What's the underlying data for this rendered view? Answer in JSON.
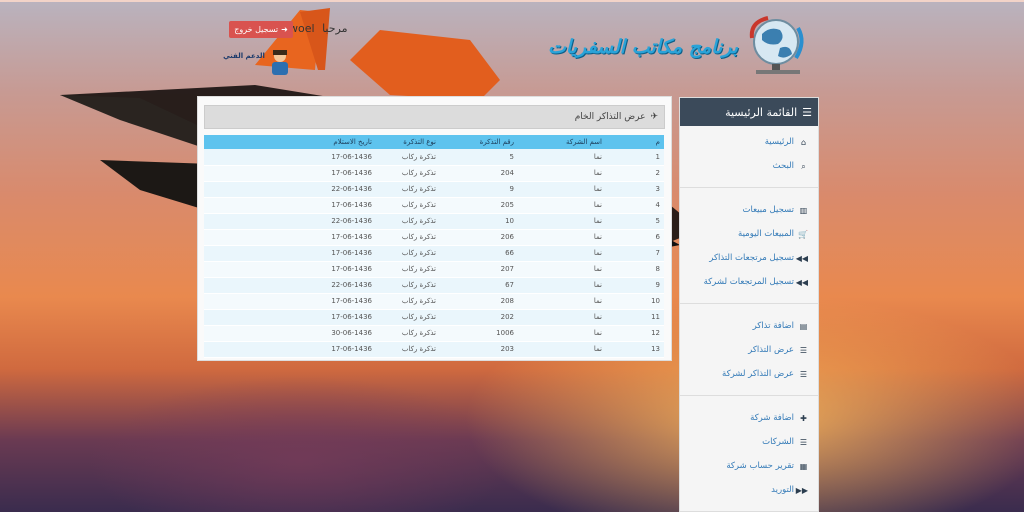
{
  "header": {
    "logo_text": "برنامج مكاتب السفريات",
    "greeting": "مرحبا",
    "username": "woel",
    "logout_label": "تسجيل خروج",
    "avatar_caption": "الدعم الفني"
  },
  "sidebar": {
    "title": "القائمة الرئيسية",
    "groups": [
      [
        {
          "label": "الرئيسية",
          "icon": "home-icon"
        },
        {
          "label": "البحث",
          "icon": "search-icon"
        }
      ],
      [
        {
          "label": "تسجيل مبيعات",
          "icon": "barcode-icon"
        },
        {
          "label": "المبيعات اليومية",
          "icon": "cart-icon"
        },
        {
          "label": "تسجيل مرتجعات التذاكر",
          "icon": "backward-icon"
        },
        {
          "label": "تسجيل المرتجعات لشركة",
          "icon": "backward-icon"
        }
      ],
      [
        {
          "label": "اضافة تذاكر",
          "icon": "file-icon"
        },
        {
          "label": "عرض التذاكر",
          "icon": "list-icon"
        },
        {
          "label": "عرض التذاكر لشركة",
          "icon": "list-icon"
        }
      ],
      [
        {
          "label": "اضافة شركة",
          "icon": "plus-icon"
        },
        {
          "label": "الشركات",
          "icon": "list-icon"
        },
        {
          "label": "تقرير حساب شركة",
          "icon": "list-alt-icon"
        },
        {
          "label": "التوريد",
          "icon": "forward-icon"
        }
      ]
    ]
  },
  "panel": {
    "title": "عرض التذاكر الخام",
    "columns": [
      "م",
      "اسم الشركة",
      "رقم التذكرة",
      "نوع التذكرة",
      "تاريخ الاستلام"
    ],
    "rows": [
      [
        "1",
        "نما",
        "5",
        "تذكرة ركاب",
        "17-06-1436"
      ],
      [
        "2",
        "نما",
        "204",
        "تذكرة ركاب",
        "17-06-1436"
      ],
      [
        "3",
        "نما",
        "9",
        "تذكرة ركاب",
        "22-06-1436"
      ],
      [
        "4",
        "نما",
        "205",
        "تذكرة ركاب",
        "17-06-1436"
      ],
      [
        "5",
        "نما",
        "10",
        "تذكرة ركاب",
        "22-06-1436"
      ],
      [
        "6",
        "نما",
        "206",
        "تذكرة ركاب",
        "17-06-1436"
      ],
      [
        "7",
        "نما",
        "66",
        "تذكرة ركاب",
        "17-06-1436"
      ],
      [
        "8",
        "نما",
        "207",
        "تذكرة ركاب",
        "17-06-1436"
      ],
      [
        "9",
        "نما",
        "67",
        "تذكرة ركاب",
        "22-06-1436"
      ],
      [
        "10",
        "نما",
        "208",
        "تذكرة ركاب",
        "17-06-1436"
      ],
      [
        "11",
        "نما",
        "202",
        "تذكرة ركاب",
        "17-06-1436"
      ],
      [
        "12",
        "نما",
        "1006",
        "تذكرة ركاب",
        "30-06-1436"
      ],
      [
        "13",
        "نما",
        "203",
        "تذكرة ركاب",
        "17-06-1436"
      ]
    ]
  }
}
